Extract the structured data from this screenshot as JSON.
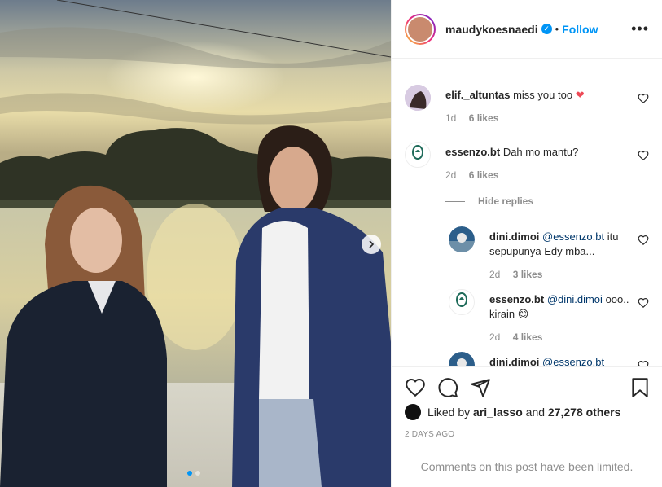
{
  "post": {
    "author": "maudykoesnaedi",
    "verified_mark": "✓",
    "separator": "•",
    "follow_label": "Follow",
    "more_label": "•••"
  },
  "comments": [
    {
      "user": "elif._altuntas",
      "text": "miss you too",
      "emoji": "❤",
      "time": "1d",
      "likes": "6 likes"
    },
    {
      "user": "essenzo.bt",
      "text": "Dah mo mantu?",
      "time": "2d",
      "likes": "6 likes",
      "avatar_text": "essenzo"
    }
  ],
  "hide_replies_label": "Hide replies",
  "replies": [
    {
      "user": "dini.dimoi",
      "mention": "@essenzo.bt",
      "text": "itu sepupunya Edy mba...",
      "time": "2d",
      "likes": "3 likes"
    },
    {
      "user": "essenzo.bt",
      "mention": "@dini.dimoi",
      "text": "ooo.. kirain",
      "emoji": "😊",
      "time": "2d",
      "likes": "4 likes",
      "avatar_text": "essenzo"
    },
    {
      "user": "dini.dimoi",
      "mention": "@essenzo.bt"
    }
  ],
  "liked_by": {
    "prefix": "Liked by",
    "user": "ari_lasso",
    "middle": "and",
    "count": "27,278 others"
  },
  "timestamp": "2 days ago",
  "comments_limited": "Comments on this post have been limited.",
  "icons": [
    "heart-icon",
    "comment-icon",
    "share-icon",
    "bookmark-icon",
    "chevron-right-icon",
    "verified-icon",
    "more-icon"
  ],
  "colors": {
    "accent": "#0095f6",
    "heart": "#ed4956",
    "muted": "#8e8e8e"
  }
}
